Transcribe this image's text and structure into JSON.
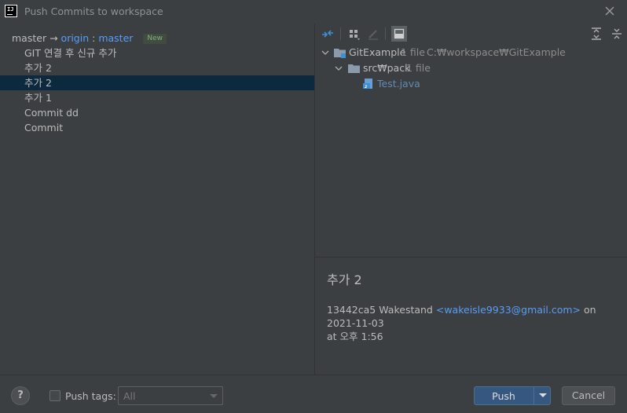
{
  "window": {
    "title": "Push Commits to workspace",
    "close_icon": "close-icon"
  },
  "branch": {
    "local": "master",
    "arrow": "→",
    "remote": "origin",
    "separator": ":",
    "remote_branch": "master",
    "badge": "New"
  },
  "commits": [
    {
      "label": "GIT 연결 후 신규 추가",
      "selected": false
    },
    {
      "label": "추가 2",
      "selected": false
    },
    {
      "label": "추가 2",
      "selected": true
    },
    {
      "label": "추가 1",
      "selected": false
    },
    {
      "label": "Commit dd",
      "selected": false
    },
    {
      "label": "Commit",
      "selected": false
    }
  ],
  "toolbar": {
    "icons": [
      "diff-icon",
      "group-by-icon",
      "edit-icon",
      "show-details-icon",
      "expand-all-icon",
      "collapse-all-icon"
    ]
  },
  "tree": {
    "root": {
      "name": "GitExample",
      "meta": "1 file",
      "path": "C:₩workspace₩GitExample"
    },
    "folder": {
      "name": "src₩pack",
      "meta": "1 file"
    },
    "file": {
      "name": "Test.java"
    }
  },
  "details": {
    "title": "추가 2",
    "hash": "13442ca5",
    "author": "Wakestand",
    "email": "<wakeisle9933@gmail.com>",
    "on": "on",
    "date": "2021-11-03",
    "time_line": "at 오후 1:56"
  },
  "bottom": {
    "help": "?",
    "push_tags_label": "Push tags:",
    "push_tags_checked": false,
    "tags_value": "All",
    "push_label": "Push",
    "cancel_label": "Cancel"
  },
  "colors": {
    "background": "#3c3f41",
    "selection": "#0d293e",
    "link": "#589df6",
    "primary_button": "#365880",
    "badge_text": "#81b17d"
  }
}
